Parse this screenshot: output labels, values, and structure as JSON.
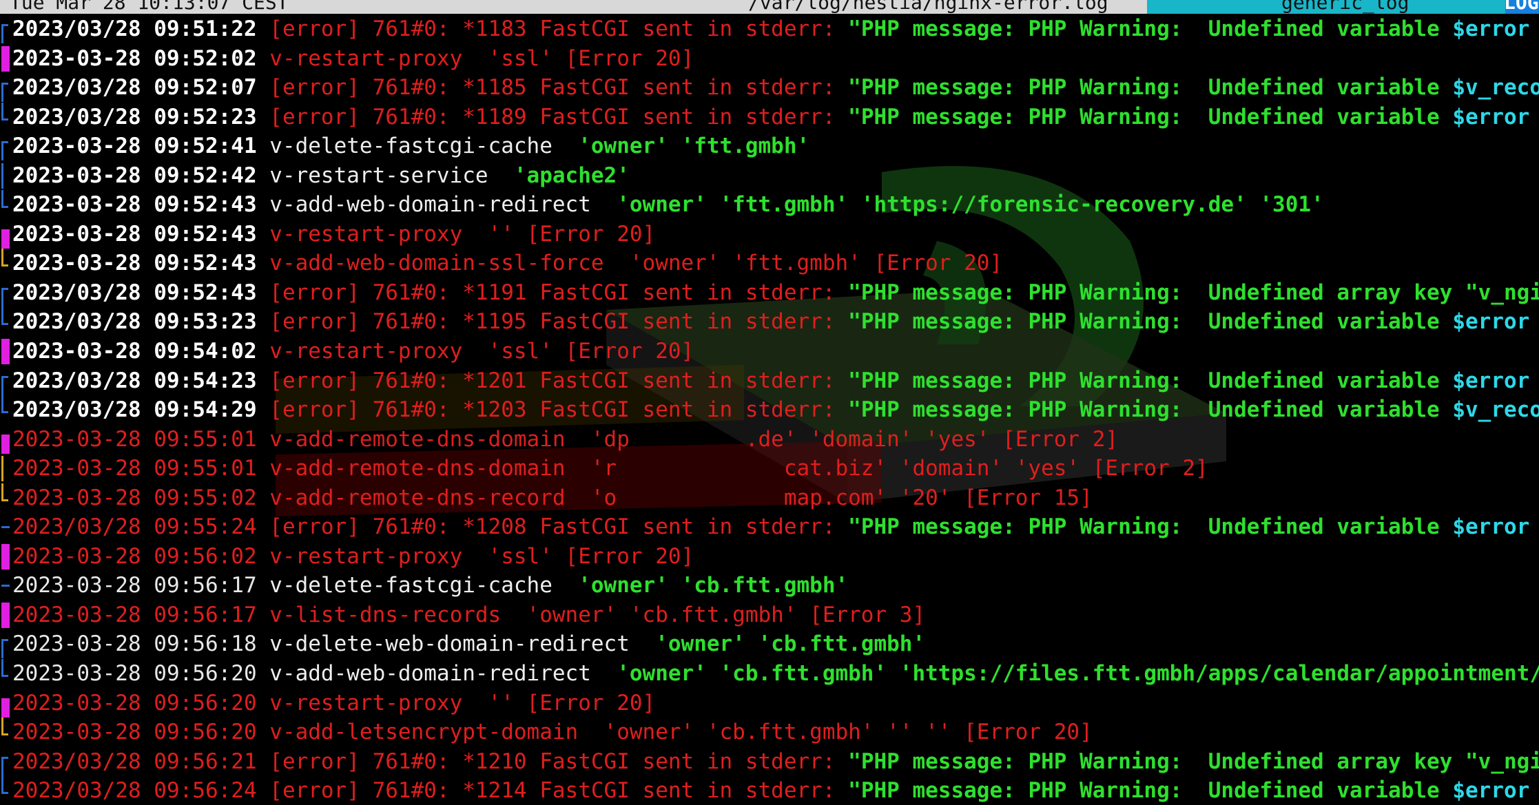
{
  "status_bar": {
    "time": "Tue Mar 28 10:13:07 CEST",
    "file_path": "/var/log/hestia/nginx-error.log",
    "format": "generic_log",
    "mode": "LOG"
  },
  "lines": [
    {
      "bracket": "top-blue",
      "ts": "2023/03/28 09:51:22",
      "parts": [
        [
          "red",
          "[error] 761#0: *1183 FastCGI sent in stderr: "
        ],
        [
          "green",
          "\"PHP message: PHP Warning:  Undefined variable "
        ],
        [
          "cyan",
          "$error i"
        ]
      ]
    },
    {
      "bracket": "magenta",
      "ts": "2023-03-28 09:52:02",
      "parts": [
        [
          "red",
          "v-restart-proxy  'ssl' [Error 20]"
        ]
      ]
    },
    {
      "bracket": "top-blue",
      "ts": "2023/03/28 09:52:07",
      "parts": [
        [
          "red",
          "[error] 761#0: *1185 FastCGI sent in stderr: "
        ],
        [
          "green",
          "\"PHP message: PHP Warning:  Undefined variable "
        ],
        [
          "cyan",
          "$v_recor"
        ]
      ]
    },
    {
      "bracket": "bottom-blue",
      "ts": "2023/03/28 09:52:23",
      "parts": [
        [
          "red",
          "[error] 761#0: *1189 FastCGI sent in stderr: "
        ],
        [
          "green",
          "\"PHP message: PHP Warning:  Undefined variable "
        ],
        [
          "cyan",
          "$error i"
        ]
      ]
    },
    {
      "bracket": "top-blue",
      "ts": "2023-03-28 09:52:41",
      "parts": [
        [
          "white",
          "v-delete-fastcgi-cache  "
        ],
        [
          "green",
          "'owner' 'ftt.gmbh'"
        ]
      ]
    },
    {
      "bracket": "mid-blue",
      "ts": "2023-03-28 09:52:42",
      "parts": [
        [
          "white",
          "v-restart-service  "
        ],
        [
          "green",
          "'apache2'"
        ]
      ]
    },
    {
      "bracket": "bottom-blue",
      "ts": "2023-03-28 09:52:43",
      "parts": [
        [
          "white",
          "v-add-web-domain-redirect  "
        ],
        [
          "green",
          "'owner' 'ftt.gmbh' 'https://forensic-recovery.de' '301'"
        ]
      ]
    },
    {
      "bracket": "magenta-top",
      "ts": "2023-03-28 09:52:43",
      "parts": [
        [
          "red",
          "v-restart-proxy  '' [Error 20]"
        ]
      ]
    },
    {
      "bracket": "yellow-bottom",
      "ts": "2023-03-28 09:52:43",
      "parts": [
        [
          "red",
          "v-add-web-domain-ssl-force  'owner' 'ftt.gmbh' [Error 20]"
        ]
      ]
    },
    {
      "bracket": "top-blue",
      "ts": "2023/03/28 09:52:43",
      "parts": [
        [
          "red",
          "[error] 761#0: *1191 FastCGI sent in stderr: "
        ],
        [
          "green",
          "\"PHP message: PHP Warning:  Undefined array key \"v_ngin"
        ]
      ]
    },
    {
      "bracket": "bottom-blue",
      "ts": "2023/03/28 09:53:23",
      "parts": [
        [
          "red",
          "[error] 761#0: *1195 FastCGI sent in stderr: "
        ],
        [
          "green",
          "\"PHP message: PHP Warning:  Undefined variable "
        ],
        [
          "cyan",
          "$error i"
        ]
      ]
    },
    {
      "bracket": "magenta",
      "ts": "2023-03-28 09:54:02",
      "parts": [
        [
          "red",
          "v-restart-proxy  'ssl' [Error 20]"
        ]
      ]
    },
    {
      "bracket": "top-blue",
      "ts": "2023/03/28 09:54:23",
      "parts": [
        [
          "red",
          "[error] 761#0: *1201 FastCGI sent in stderr: "
        ],
        [
          "green",
          "\"PHP message: PHP Warning:  Undefined variable "
        ],
        [
          "cyan",
          "$error i"
        ]
      ]
    },
    {
      "bracket": "bottom-blue",
      "ts": "2023/03/28 09:54:29",
      "parts": [
        [
          "red",
          "[error] 761#0: *1203 FastCGI sent in stderr: "
        ],
        [
          "green",
          "\"PHP message: PHP Warning:  Undefined variable "
        ],
        [
          "cyan",
          "$v_recor"
        ]
      ]
    },
    {
      "bracket": "magenta-top",
      "ts": "2023-03-28 09:55:01",
      "tsclass": "red",
      "parts": [
        [
          "red",
          "v-add-remote-dns-domain  'dp         .de' 'domain' 'yes' [Error 2]"
        ]
      ]
    },
    {
      "bracket": "yellow-mid",
      "ts": "2023-03-28 09:55:01",
      "tsclass": "red",
      "parts": [
        [
          "red",
          "v-add-remote-dns-domain  'r             cat.biz' 'domain' 'yes' [Error 2]"
        ]
      ]
    },
    {
      "bracket": "yellow-bottom",
      "ts": "2023-03-28 09:55:02",
      "tsclass": "red",
      "parts": [
        [
          "red",
          "v-add-remote-dns-record  'o             map.com' '20' [Error 15]"
        ]
      ]
    },
    {
      "bracket": "single-blue",
      "ts": "2023/03/28 09:55:24",
      "tsclass": "red",
      "parts": [
        [
          "red",
          "[error] 761#0: *1208 FastCGI sent in stderr: "
        ],
        [
          "green",
          "\"PHP message: PHP Warning:  Undefined variable "
        ],
        [
          "cyan",
          "$error i"
        ]
      ]
    },
    {
      "bracket": "magenta",
      "ts": "2023-03-28 09:56:02",
      "tsclass": "red",
      "parts": [
        [
          "red",
          "v-restart-proxy  'ssl' [Error 20]"
        ]
      ]
    },
    {
      "bracket": "single-blue",
      "ts": "2023-03-28 09:56:17",
      "tsclass": "white",
      "parts": [
        [
          "white",
          "v-delete-fastcgi-cache  "
        ],
        [
          "green",
          "'owner' 'cb.ftt.gmbh'"
        ]
      ]
    },
    {
      "bracket": "magenta",
      "ts": "2023-03-28 09:56:17",
      "tsclass": "red",
      "parts": [
        [
          "red",
          "v-list-dns-records  'owner' 'cb.ftt.gmbh' [Error 3]"
        ]
      ]
    },
    {
      "bracket": "top-blue",
      "ts": "2023-03-28 09:56:18",
      "tsclass": "white",
      "parts": [
        [
          "white",
          "v-delete-web-domain-redirect  "
        ],
        [
          "green",
          "'owner' 'cb.ftt.gmbh'"
        ]
      ]
    },
    {
      "bracket": "bottom-blue",
      "ts": "2023-03-28 09:56:20",
      "tsclass": "white",
      "parts": [
        [
          "white",
          "v-add-web-domain-redirect  "
        ],
        [
          "green",
          "'owner' 'cb.ftt.gmbh' 'https://files.ftt.gmbh/apps/calendar/appointment/Q"
        ]
      ]
    },
    {
      "bracket": "magenta-top",
      "ts": "2023-03-28 09:56:20",
      "tsclass": "red",
      "parts": [
        [
          "red",
          "v-restart-proxy  '' [Error 20]"
        ]
      ]
    },
    {
      "bracket": "yellow-bottom",
      "ts": "2023-03-28 09:56:20",
      "tsclass": "red",
      "parts": [
        [
          "red",
          "v-add-letsencrypt-domain  'owner' 'cb.ftt.gmbh' '' '' [Error 20]"
        ]
      ]
    },
    {
      "bracket": "top-blue",
      "ts": "2023/03/28 09:56:21",
      "tsclass": "red",
      "parts": [
        [
          "red",
          "[error] 761#0: *1210 FastCGI sent in stderr: "
        ],
        [
          "green",
          "\"PHP message: PHP Warning:  Undefined array key \"v_ngin"
        ]
      ]
    },
    {
      "bracket": "bottom-blue",
      "ts": "2023/03/28 09:56:24",
      "tsclass": "red",
      "parts": [
        [
          "red",
          "[error] 761#0: *1214 FastCGI sent in stderr: "
        ],
        [
          "green",
          "\"PHP message: PHP Warning:  Undefined variable "
        ],
        [
          "cyan",
          "$error i"
        ]
      ]
    }
  ],
  "colors": {
    "status_bg": "#d8d8d8",
    "format_bg": "#19b5c8",
    "mode_bg": "#1580e0",
    "error_red": "#e01e1e",
    "string_green": "#2ee02e",
    "variable_cyan": "#2dd8e8",
    "bracket_blue": "#2b6bd0",
    "bracket_magenta": "#e020e0",
    "bracket_yellow": "#d9a520"
  }
}
